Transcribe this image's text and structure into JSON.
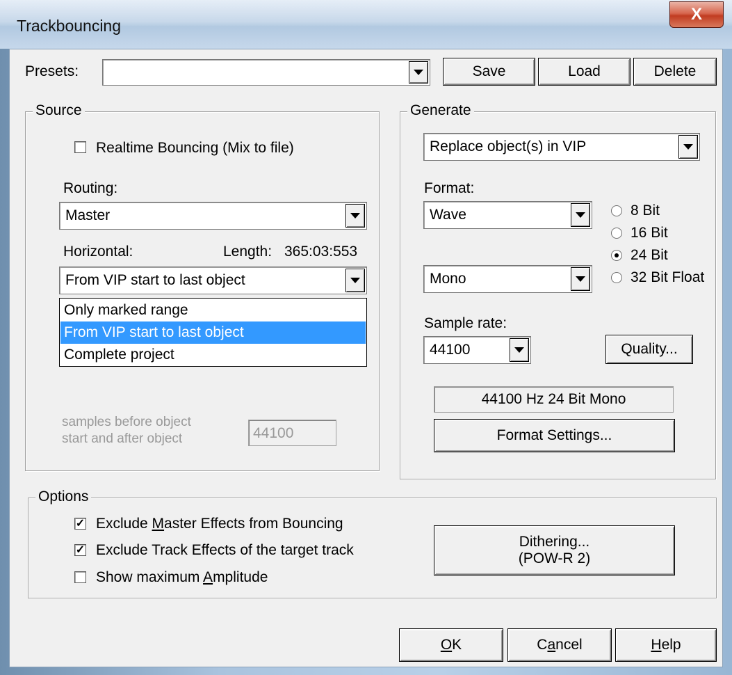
{
  "window": {
    "title": "Trackbouncing",
    "close_glyph": "X"
  },
  "presets": {
    "label": "Presets:",
    "value": "",
    "save": "Save",
    "load": "Load",
    "delete": "Delete"
  },
  "source": {
    "legend": "Source",
    "realtime_label": "Realtime Bouncing (Mix to file)",
    "realtime_checked": false,
    "routing_label": "Routing:",
    "routing_value": "Master",
    "horizontal_label": "Horizontal:",
    "length_label": "Length:",
    "length_value": "365:03:553",
    "horizontal_value": "From VIP start to last object",
    "horizontal_options": [
      "Only marked range",
      "From VIP start to last object",
      "Complete project"
    ],
    "samples_label_line1": "samples before object",
    "samples_label_line2": "start and after object",
    "samples_value": "44100"
  },
  "generate": {
    "legend": "Generate",
    "mode_value": "Replace object(s)  in VIP",
    "format_label": "Format:",
    "format_value": "Wave",
    "bit_options": [
      "8 Bit",
      "16 Bit",
      "24 Bit",
      "32 Bit Float"
    ],
    "bit_selected": "24 Bit",
    "channel_value": "Mono",
    "sample_rate_label": "Sample rate:",
    "sample_rate_value": "44100",
    "quality_button": "Quality...",
    "summary": "44100 Hz  24 Bit  Mono",
    "format_settings_button": "Format Settings..."
  },
  "options": {
    "legend": "Options",
    "exclude_master": {
      "pre": "Exclude ",
      "key": "M",
      "post": "aster Effects from Bouncing",
      "checked": true
    },
    "exclude_track": {
      "label": "Exclude Track Effects of the target track",
      "checked": true
    },
    "show_amplitude": {
      "pre": "Show maximum ",
      "key": "A",
      "post": "mplitude",
      "checked": false
    },
    "dithering_line1": "Dithering...",
    "dithering_line2": "(POW-R 2)"
  },
  "footer": {
    "ok": {
      "key": "O",
      "rest": "K"
    },
    "cancel": {
      "pre": "C",
      "key": "a",
      "post": "ncel"
    },
    "help": {
      "key": "H",
      "rest": "elp"
    }
  },
  "colors": {
    "highlight": "#3399ff",
    "close_red": "#c13c21"
  }
}
